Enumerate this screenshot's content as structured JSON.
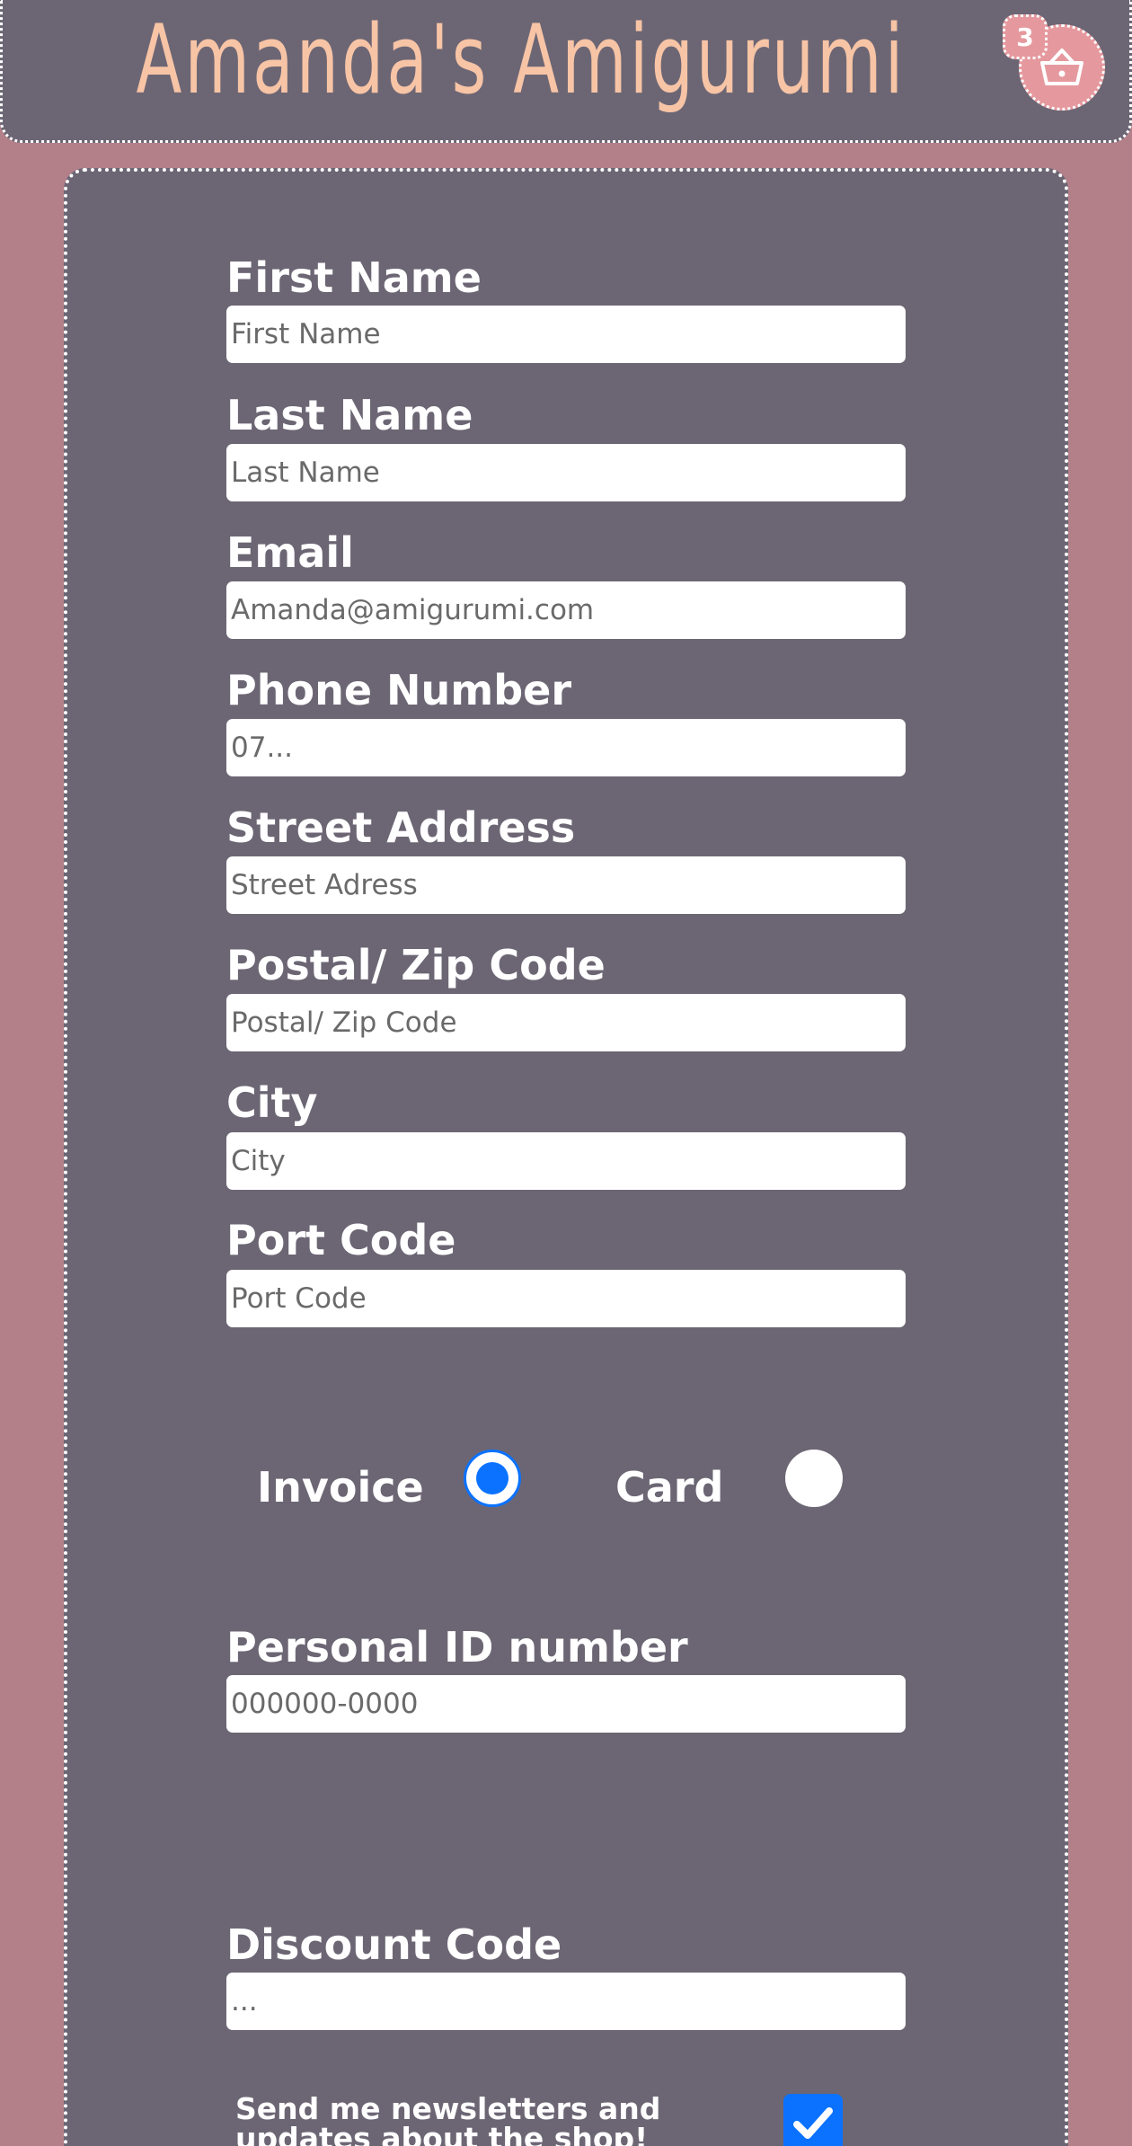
{
  "header": {
    "title": "Amanda's Amigurumi",
    "cart_count": "3",
    "cart_icon": "basket-icon"
  },
  "form": {
    "fields": [
      {
        "label": "First Name",
        "placeholder": "First Name",
        "value": ""
      },
      {
        "label": "Last Name",
        "placeholder": "Last Name",
        "value": ""
      },
      {
        "label": "Email",
        "placeholder": "Amanda@amigurumi.com",
        "value": ""
      },
      {
        "label": "Phone Number",
        "placeholder": "07...",
        "value": ""
      },
      {
        "label": "Street Address",
        "placeholder": "Street Adress",
        "value": ""
      },
      {
        "label": "Postal/ Zip Code",
        "placeholder": "Postal/ Zip Code",
        "value": ""
      },
      {
        "label": "City",
        "placeholder": "City",
        "value": ""
      },
      {
        "label": "Port Code",
        "placeholder": "Port Code",
        "value": ""
      }
    ],
    "payment": {
      "invoice_label": "Invoice",
      "card_label": "Card",
      "selected": "invoice"
    },
    "personal_id": {
      "label": "Personal ID number",
      "placeholder": "000000-0000"
    },
    "discount": {
      "label": "Discount Code",
      "placeholder": "..."
    },
    "newsletter": {
      "label": "Send me newsletters and updates about the shop!",
      "checked": true
    }
  },
  "colors": {
    "background": "#b3808a",
    "panel": "#6c6674",
    "title": "#f7c4a6",
    "cart": "#e5999e",
    "accent": "#0a72ff"
  }
}
